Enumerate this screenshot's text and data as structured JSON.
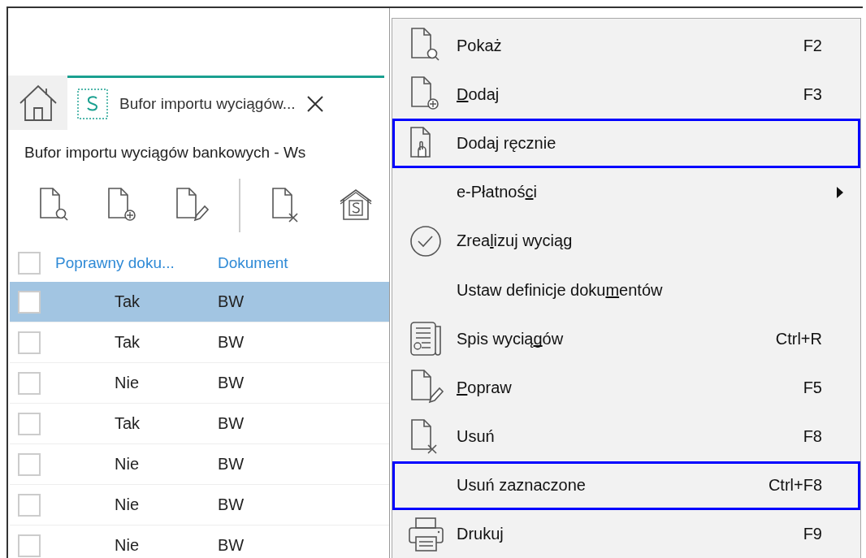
{
  "tabs": [
    {
      "kind": "home",
      "selected": false
    },
    {
      "kind": "document",
      "label": "Bufor importu wyciągów...",
      "selected": true
    }
  ],
  "page_title": "Bufor importu wyciągów bankowych - Ws",
  "toolbar": [
    {
      "kind": "preview"
    },
    {
      "kind": "add"
    },
    {
      "kind": "edit"
    },
    {
      "kind": "separator"
    },
    {
      "kind": "delete"
    },
    {
      "kind": "bank"
    }
  ],
  "table": {
    "columns": [
      "Poprawny doku...",
      "Dokument"
    ],
    "header_checked": false,
    "rows": [
      {
        "selected": true,
        "checked": false,
        "cells": [
          "Tak",
          "BW"
        ]
      },
      {
        "selected": false,
        "checked": false,
        "cells": [
          "Tak",
          "BW"
        ]
      },
      {
        "selected": false,
        "checked": false,
        "cells": [
          "Nie",
          "BW"
        ]
      },
      {
        "selected": false,
        "checked": false,
        "cells": [
          "Tak",
          "BW"
        ]
      },
      {
        "selected": false,
        "checked": false,
        "cells": [
          "Nie",
          "BW"
        ]
      },
      {
        "selected": false,
        "checked": false,
        "cells": [
          "Nie",
          "BW"
        ]
      },
      {
        "selected": false,
        "checked": false,
        "cells": [
          "Nie",
          "BW"
        ]
      }
    ]
  },
  "context_menu": {
    "items": [
      {
        "kind": "preview",
        "label": "Pokaż",
        "shortcut": "F2",
        "highlighted": false,
        "submenu": false
      },
      {
        "kind": "add",
        "label": [
          {
            "text": "D",
            "underlined": true
          },
          {
            "text": "odaj",
            "underlined": false
          }
        ],
        "shortcut": "F3",
        "highlighted": false,
        "submenu": false
      },
      {
        "kind": "hand",
        "label": "Dodaj ręcznie",
        "highlighted": true,
        "submenu": false
      },
      {
        "kind": "plain",
        "label": [
          {
            "text": "e-Płatnoś",
            "underlined": false
          },
          {
            "text": "c",
            "underlined": true
          },
          {
            "text": "i",
            "underlined": false
          }
        ],
        "highlighted": false,
        "submenu": true
      },
      {
        "kind": "check",
        "label": [
          {
            "text": "Zrea",
            "underlined": false
          },
          {
            "text": "l",
            "underlined": true
          },
          {
            "text": "izuj wyciąg",
            "underlined": false
          }
        ],
        "highlighted": false,
        "submenu": false
      },
      {
        "kind": "plain",
        "label": [
          {
            "text": "Ustaw definicje doku",
            "underlined": false
          },
          {
            "text": "m",
            "underlined": true
          },
          {
            "text": "entów",
            "underlined": false
          }
        ],
        "highlighted": false,
        "submenu": false
      },
      {
        "kind": "list",
        "label": [
          {
            "text": "Spis wycią",
            "underlined": false
          },
          {
            "text": "g",
            "underlined": true
          },
          {
            "text": "ów",
            "underlined": false
          }
        ],
        "shortcut": "Ctrl+R",
        "highlighted": false,
        "submenu": false
      },
      {
        "kind": "edit",
        "label": [
          {
            "text": "P",
            "underlined": true
          },
          {
            "text": "opraw",
            "underlined": false
          }
        ],
        "shortcut": "F5",
        "highlighted": false,
        "submenu": false
      },
      {
        "kind": "delete",
        "label": "Usuń",
        "shortcut": "F8",
        "highlighted": false,
        "submenu": false
      },
      {
        "kind": "plain",
        "label": "Usuń zaznaczone",
        "shortcut": "Ctrl+F8",
        "highlighted": true,
        "submenu": false
      },
      {
        "kind": "print",
        "label": "Drukuj",
        "shortcut": "F9",
        "highlighted": false,
        "submenu": false
      }
    ]
  }
}
